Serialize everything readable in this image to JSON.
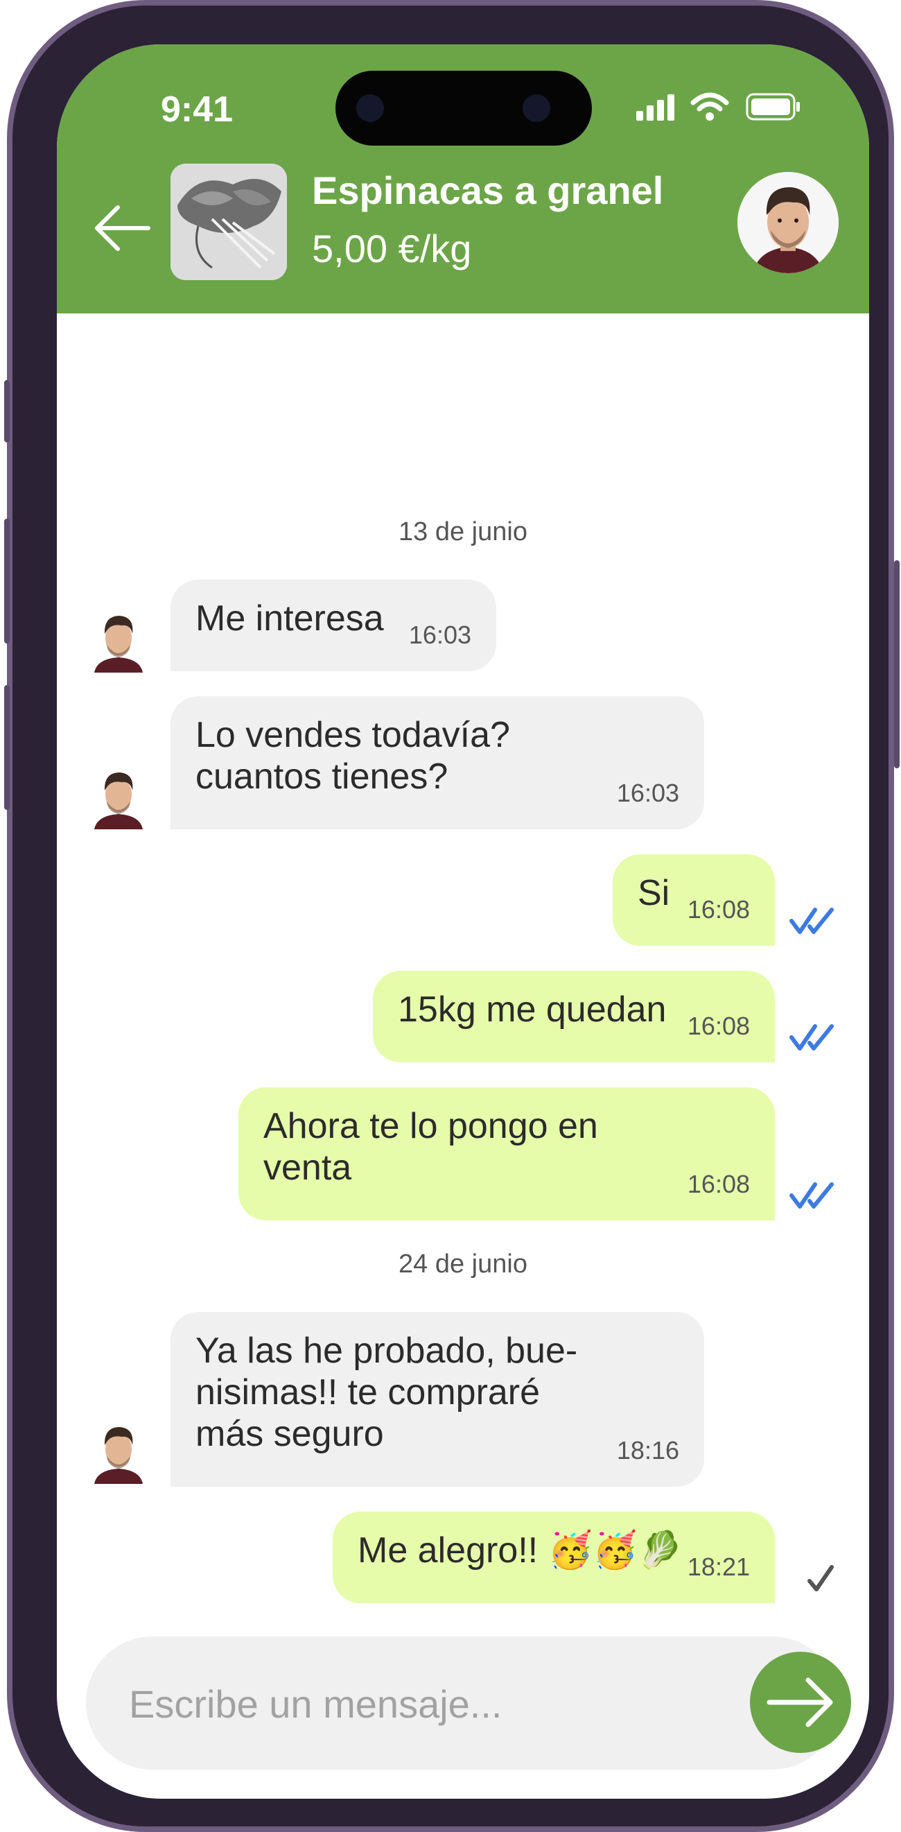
{
  "status_bar": {
    "time": "9:41"
  },
  "header": {
    "product_title": "Espinacas a granel",
    "product_price": "5,00 €/kg"
  },
  "chat": {
    "date_1": "13 de junio",
    "date_2": "24 de junio",
    "messages": [
      {
        "side": "in",
        "text": "Me interesa",
        "time": "16:03"
      },
      {
        "side": "in",
        "text": "Lo vendes todavía?\ncuantos tienes?",
        "time": "16:03"
      },
      {
        "side": "out",
        "text": "Si",
        "time": "16:08",
        "status": "read"
      },
      {
        "side": "out",
        "text": "15kg me quedan",
        "time": "16:08",
        "status": "read"
      },
      {
        "side": "out",
        "text": "Ahora te lo pongo en\nventa",
        "time": "16:08",
        "status": "read"
      },
      {
        "side": "in",
        "text": "Ya las he probado, bue-\nnisimas!! te compraré\nmás seguro",
        "time": "18:16"
      },
      {
        "side": "out",
        "text": "Me alegro!! 🥳🥳🥬",
        "time": "18:21",
        "status": "sent"
      }
    ]
  },
  "composer": {
    "placeholder": "Escribe un mensaje..."
  },
  "colors": {
    "brand_green": "#6ca548",
    "outgoing_bubble": "#e6fcaa",
    "incoming_bubble": "#f0f0f0",
    "read_tick": "#3d7be0",
    "sent_tick": "#555555"
  },
  "icons": {
    "back": "arrow-left-icon",
    "send": "arrow-right-icon",
    "read": "double-check-icon",
    "sent": "single-check-icon"
  }
}
